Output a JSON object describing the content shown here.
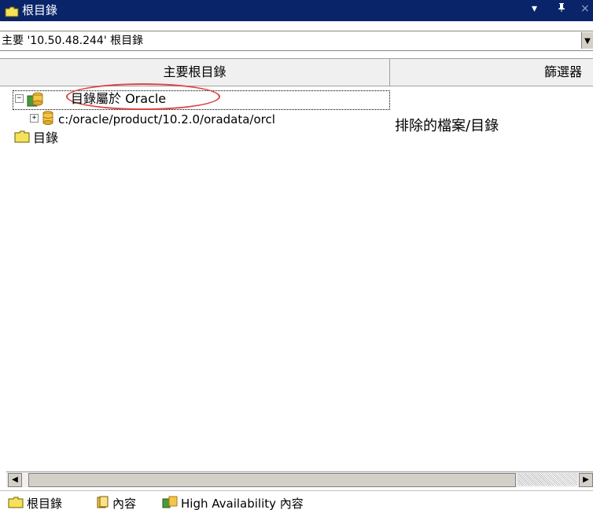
{
  "window": {
    "title": "根目錄",
    "dropdown_glyph": "▾",
    "pin_glyph": "ᵖ",
    "close_glyph": "×"
  },
  "address": {
    "text": "主要 '10.50.48.244' 根目錄",
    "dropdown_glyph": "▼"
  },
  "columns": {
    "primary_root": "主要根目錄",
    "filter": "篩選器"
  },
  "tree": {
    "expand_glyph": "−",
    "collapse_glyph": "+",
    "oracle_node": "目錄屬於 Oracle",
    "oracle_child": "c:/oracle/product/10.2.0/oradata/orcl",
    "folder_node": "目錄"
  },
  "filter_cell": "排除的檔案/目錄",
  "scroll": {
    "left_glyph": "◀",
    "right_glyph": "▶"
  },
  "tabs": [
    {
      "label": "根目錄"
    },
    {
      "label": "內容"
    },
    {
      "label": "High Availability 內容"
    }
  ],
  "colors": {
    "titlebar": "#0a246a",
    "folder_yellow": "#f6e15a",
    "highlight_oval": "#dd4444"
  }
}
